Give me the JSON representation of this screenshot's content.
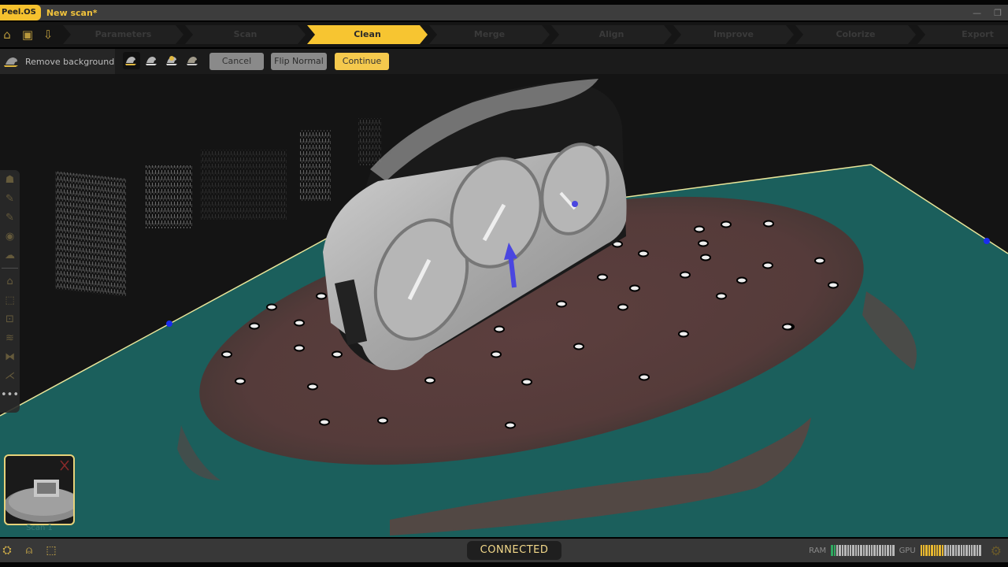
{
  "app": {
    "brand": "Peel.OS",
    "document_title": "New scan*",
    "window_controls": {
      "minimize": "—",
      "restore": "❐"
    }
  },
  "quick_actions": [
    {
      "name": "home-icon",
      "glyph": "⌂"
    },
    {
      "name": "save-icon",
      "glyph": "▣"
    },
    {
      "name": "export-save-icon",
      "glyph": "⇩"
    }
  ],
  "workflow_steps": [
    {
      "label": "Parameters",
      "active": false
    },
    {
      "label": "Scan",
      "active": false
    },
    {
      "label": "Clean",
      "active": true
    },
    {
      "label": "Merge",
      "active": false
    },
    {
      "label": "Align",
      "active": false
    },
    {
      "label": "Improve",
      "active": false
    },
    {
      "label": "Colorize",
      "active": false
    },
    {
      "label": "Export",
      "active": false
    }
  ],
  "toolbar": {
    "mode_label": "Remove background",
    "tools": [
      "remove-background-auto",
      "remove-background-plane",
      "remove-background-point",
      "remove-background-select"
    ],
    "selected_tool_index": 0,
    "cancel_label": "Cancel",
    "flip_normal_label": "Flip Normal",
    "continue_label": "Continue"
  },
  "colors": {
    "accent": "#f7c531",
    "plane": "#1b5f5c",
    "plane_edge": "#e8e59a",
    "turntable": "#5a3e3c",
    "viewport_bg": "#141414",
    "axis_arrow": "#4a46e0"
  },
  "scans": [
    {
      "label": "Scan 1"
    }
  ],
  "status": {
    "connection": "CONNECTED",
    "ram_label": "RAM",
    "ram_usage_fraction": 0.08,
    "gpu_label": "GPU",
    "gpu_usage_fraction": 0.39
  }
}
